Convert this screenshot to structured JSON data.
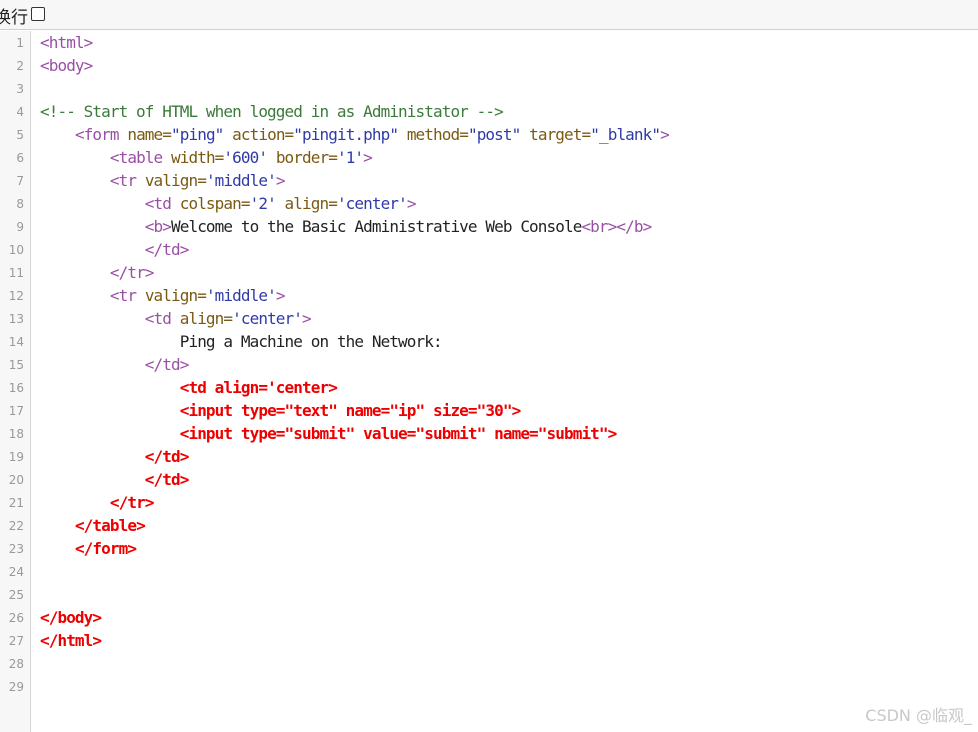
{
  "toolbar": {
    "wrap_label": "换行",
    "wrap_checked": false
  },
  "code_lines": [
    {
      "n": "1",
      "t": [
        [
          "t",
          "<html>"
        ]
      ]
    },
    {
      "n": "2",
      "t": [
        [
          "t",
          "<body>"
        ]
      ]
    },
    {
      "n": "3",
      "t": []
    },
    {
      "n": "4",
      "t": [
        [
          "c",
          "<!-- Start of HTML when logged in as Administator -->"
        ]
      ]
    },
    {
      "n": "5",
      "t": [
        [
          "x",
          "    "
        ],
        [
          "t",
          "<form "
        ],
        [
          "a",
          "name="
        ],
        [
          "s",
          "\"ping\""
        ],
        [
          "x",
          " "
        ],
        [
          "a",
          "action="
        ],
        [
          "s",
          "\"pingit.php\""
        ],
        [
          "x",
          " "
        ],
        [
          "a",
          "method="
        ],
        [
          "s",
          "\"post\""
        ],
        [
          "x",
          " "
        ],
        [
          "a",
          "target="
        ],
        [
          "s",
          "\"_blank\""
        ],
        [
          "t",
          ">"
        ]
      ]
    },
    {
      "n": "6",
      "t": [
        [
          "x",
          "        "
        ],
        [
          "t",
          "<table "
        ],
        [
          "a",
          "width="
        ],
        [
          "s",
          "'600'"
        ],
        [
          "x",
          " "
        ],
        [
          "a",
          "border="
        ],
        [
          "s",
          "'1'"
        ],
        [
          "t",
          ">"
        ]
      ]
    },
    {
      "n": "7",
      "t": [
        [
          "x",
          "        "
        ],
        [
          "t",
          "<tr "
        ],
        [
          "a",
          "valign="
        ],
        [
          "s",
          "'middle'"
        ],
        [
          "t",
          ">"
        ]
      ]
    },
    {
      "n": "8",
      "t": [
        [
          "x",
          "            "
        ],
        [
          "t",
          "<td "
        ],
        [
          "a",
          "colspan="
        ],
        [
          "s",
          "'2'"
        ],
        [
          "x",
          " "
        ],
        [
          "a",
          "align="
        ],
        [
          "s",
          "'center'"
        ],
        [
          "t",
          ">"
        ]
      ]
    },
    {
      "n": "9",
      "t": [
        [
          "x",
          "            "
        ],
        [
          "t",
          "<b>"
        ],
        [
          "x",
          "Welcome to the Basic Administrative Web Console"
        ],
        [
          "t",
          "<br></b>"
        ]
      ]
    },
    {
      "n": "10",
      "t": [
        [
          "x",
          "            "
        ],
        [
          "t",
          "</td>"
        ]
      ]
    },
    {
      "n": "11",
      "t": [
        [
          "x",
          "        "
        ],
        [
          "t",
          "</tr>"
        ]
      ]
    },
    {
      "n": "12",
      "t": [
        [
          "x",
          "        "
        ],
        [
          "t",
          "<tr "
        ],
        [
          "a",
          "valign="
        ],
        [
          "s",
          "'middle'"
        ],
        [
          "t",
          ">"
        ]
      ]
    },
    {
      "n": "13",
      "t": [
        [
          "x",
          "            "
        ],
        [
          "t",
          "<td "
        ],
        [
          "a",
          "align="
        ],
        [
          "s",
          "'center'"
        ],
        [
          "t",
          ">"
        ]
      ]
    },
    {
      "n": "14",
      "t": [
        [
          "x",
          "                Ping a Machine on the Network:"
        ]
      ]
    },
    {
      "n": "15",
      "t": [
        [
          "x",
          "            "
        ],
        [
          "t",
          "</td>"
        ]
      ]
    },
    {
      "n": "16",
      "t": [
        [
          "x",
          "                "
        ],
        [
          "r",
          "<td align='center>"
        ]
      ]
    },
    {
      "n": "17",
      "t": [
        [
          "x",
          "                "
        ],
        [
          "r",
          "<input type=\"text\" name=\"ip\" size=\"30\">"
        ]
      ]
    },
    {
      "n": "18",
      "t": [
        [
          "x",
          "                "
        ],
        [
          "r",
          "<input type=\"submit\" value=\"submit\" name=\"submit\">"
        ]
      ]
    },
    {
      "n": "19",
      "t": [
        [
          "x",
          "            "
        ],
        [
          "r",
          "</td>"
        ]
      ]
    },
    {
      "n": "20",
      "t": [
        [
          "x",
          "            "
        ],
        [
          "r",
          "</td>"
        ]
      ]
    },
    {
      "n": "21",
      "t": [
        [
          "x",
          "        "
        ],
        [
          "r",
          "</tr>"
        ]
      ]
    },
    {
      "n": "22",
      "t": [
        [
          "x",
          "    "
        ],
        [
          "r",
          "</table>"
        ]
      ]
    },
    {
      "n": "23",
      "t": [
        [
          "x",
          "    "
        ],
        [
          "r",
          "</form>"
        ]
      ]
    },
    {
      "n": "24",
      "t": []
    },
    {
      "n": "25",
      "t": []
    },
    {
      "n": "26",
      "t": [
        [
          "r",
          "</body>"
        ]
      ]
    },
    {
      "n": "27",
      "t": [
        [
          "r",
          "</html>"
        ]
      ]
    },
    {
      "n": "28",
      "t": []
    },
    {
      "n": "29",
      "t": []
    }
  ],
  "watermark": "CSDN @临观_"
}
